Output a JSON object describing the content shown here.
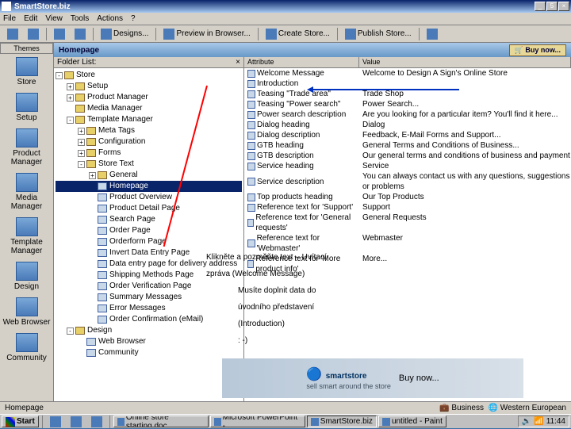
{
  "window": {
    "title": "SmartStore.biz",
    "min": "_",
    "max": "□",
    "close": "×",
    "restore": "5"
  },
  "menu": [
    "File",
    "Edit",
    "View",
    "Tools",
    "Actions",
    "?"
  ],
  "toolbar": {
    "designs": "Designs...",
    "preview": "Preview in Browser...",
    "create": "Create Store...",
    "publish": "Publish Store..."
  },
  "lefttab": "Themes",
  "nav": [
    {
      "label": "Store"
    },
    {
      "label": "Setup"
    },
    {
      "label": "Product Manager"
    },
    {
      "label": "Media Manager"
    },
    {
      "label": "Template Manager"
    },
    {
      "label": "Design"
    },
    {
      "label": "Web Browser"
    },
    {
      "label": "Community"
    }
  ],
  "page": {
    "title": "Homepage",
    "buynow": "🛒 Buy now..."
  },
  "folderhdr": "Folder List:",
  "tree": [
    {
      "ind": 0,
      "box": "-",
      "ico": "f",
      "label": "Store"
    },
    {
      "ind": 1,
      "box": "+",
      "ico": "f",
      "label": "Setup"
    },
    {
      "ind": 1,
      "box": "+",
      "ico": "f",
      "label": "Product Manager"
    },
    {
      "ind": 1,
      "box": "",
      "ico": "f",
      "label": "Media Manager"
    },
    {
      "ind": 1,
      "box": "-",
      "ico": "f",
      "label": "Template Manager"
    },
    {
      "ind": 2,
      "box": "+",
      "ico": "f",
      "label": "Meta Tags"
    },
    {
      "ind": 2,
      "box": "+",
      "ico": "f",
      "label": "Configuration"
    },
    {
      "ind": 2,
      "box": "+",
      "ico": "f",
      "label": "Forms"
    },
    {
      "ind": 2,
      "box": "-",
      "ico": "f",
      "label": "Store Text"
    },
    {
      "ind": 3,
      "box": "+",
      "ico": "f",
      "label": "General"
    },
    {
      "ind": 3,
      "box": "",
      "ico": "p",
      "label": "Homepage",
      "sel": true
    },
    {
      "ind": 3,
      "box": "",
      "ico": "p",
      "label": "Product Overview"
    },
    {
      "ind": 3,
      "box": "",
      "ico": "p",
      "label": "Product Detail Page"
    },
    {
      "ind": 3,
      "box": "",
      "ico": "p",
      "label": "Search Page"
    },
    {
      "ind": 3,
      "box": "",
      "ico": "p",
      "label": "Order Page"
    },
    {
      "ind": 3,
      "box": "",
      "ico": "p",
      "label": "Orderform Page"
    },
    {
      "ind": 3,
      "box": "",
      "ico": "p",
      "label": "Invert Data Entry Page"
    },
    {
      "ind": 3,
      "box": "",
      "ico": "p",
      "label": "Data entry page for delivery address"
    },
    {
      "ind": 3,
      "box": "",
      "ico": "p",
      "label": "Shipping Methods Page"
    },
    {
      "ind": 3,
      "box": "",
      "ico": "p",
      "label": "Order Verification Page"
    },
    {
      "ind": 3,
      "box": "",
      "ico": "p",
      "label": "Summary Messages"
    },
    {
      "ind": 3,
      "box": "",
      "ico": "p",
      "label": "Error Messages"
    },
    {
      "ind": 3,
      "box": "",
      "ico": "p",
      "label": "Order Confirmation (eMail)"
    },
    {
      "ind": 1,
      "box": "-",
      "ico": "f",
      "label": "Design"
    },
    {
      "ind": 2,
      "box": "",
      "ico": "p",
      "label": "Web Browser"
    },
    {
      "ind": 2,
      "box": "",
      "ico": "p",
      "label": "Community"
    }
  ],
  "listcols": {
    "c1": "Attribute",
    "c2": "Value"
  },
  "rows": [
    {
      "a": "Welcome Message",
      "v": "Welcome to Design A Sign's Online Store"
    },
    {
      "a": "Introduction",
      "v": ""
    },
    {
      "a": "Teasing \"Trade area\"",
      "v": "Trade Shop"
    },
    {
      "a": "Teasing \"Power search\"",
      "v": "Power Search..."
    },
    {
      "a": "Power search description",
      "v": "Are you looking for a particular item? You'll find it here..."
    },
    {
      "a": "Dialog heading",
      "v": "Dialog"
    },
    {
      "a": "Dialog description",
      "v": "Feedback, E-Mail Forms and Support..."
    },
    {
      "a": "GTB heading",
      "v": "General Terms and Conditions of Business..."
    },
    {
      "a": "GTB description",
      "v": "Our general terms and conditions of business and payment"
    },
    {
      "a": "Service heading",
      "v": "Service"
    },
    {
      "a": "Service description",
      "v": "You can always contact us with any questions, suggestions or problems"
    },
    {
      "a": "Top products heading",
      "v": "Our Top Products"
    },
    {
      "a": "Reference text for 'Support'",
      "v": "Support"
    },
    {
      "a": "Reference text for 'General requests'",
      "v": "General Requests"
    },
    {
      "a": "Reference text for 'Webmaster'",
      "v": "Webmaster"
    },
    {
      "a": "Reference text for 'More product info'",
      "v": "More..."
    }
  ],
  "annot": {
    "l1": "Klikněte a pozměňte text – Uvítací",
    "l2": "zpráva (Welcome Message)",
    "l3": "Musíte doplnit data do",
    "l4": "úvodního představení",
    "l5": "(Introduction)",
    "l6": ": -)"
  },
  "banner": {
    "logo": "smartstore",
    "sub": "sell smart around the store",
    "buy": "Buy now..."
  },
  "status": {
    "left": "Homepage",
    "mid": "💼 Business",
    "right": "🌐 Western European"
  },
  "taskbar": {
    "start": "Start",
    "tasks": [
      "Online store starting.doc",
      "Microsoft PowerPoint - ...",
      "SmartStore.biz",
      "untitled - Paint"
    ],
    "time": "11:44"
  }
}
